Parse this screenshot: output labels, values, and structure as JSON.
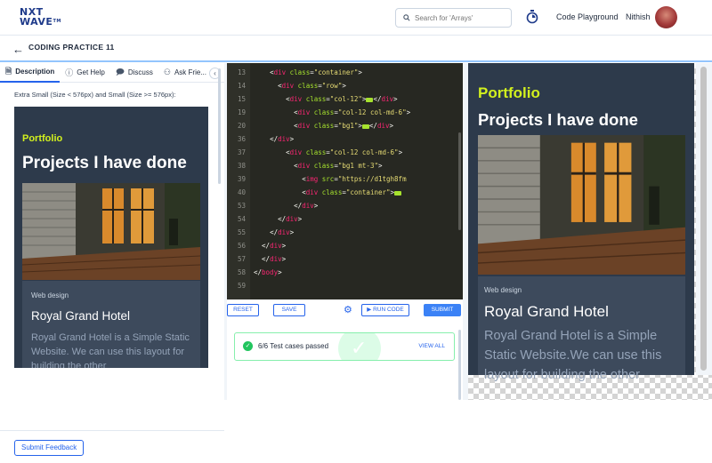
{
  "header": {
    "logo_line1": "NXT",
    "logo_line2": "WAVE",
    "logo_tm": "TM",
    "search_placeholder": "Search for 'Arrays'",
    "playground_label": "Code Playground",
    "user_name": "Nithish"
  },
  "subheader": {
    "title": "CODING PRACTICE 11"
  },
  "left_panel": {
    "tabs": [
      {
        "label": "Description",
        "icon": "document-icon"
      },
      {
        "label": "Get Help",
        "icon": "help-icon"
      },
      {
        "label": "Discuss",
        "icon": "chat-icon"
      },
      {
        "label": "Ask Frie...",
        "icon": "people-icon"
      }
    ],
    "description_text": "Extra Small (Size < 576px) and Small (Size >= 576px):",
    "preview": {
      "portfolio": "Portfolio",
      "title": "Projects I have done",
      "tag": "Web design",
      "hotel": "Royal Grand Hotel",
      "paragraph": "Royal Grand Hotel is a Simple Static Website. We can use this layout for building the other"
    },
    "feedback_button": "Submit Feedback"
  },
  "editor": {
    "lines": [
      {
        "num": "13",
        "indent": "    ",
        "code": [
          [
            "punct",
            "<"
          ],
          [
            "tag-name",
            "div "
          ],
          [
            "attr",
            "class"
          ],
          [
            "punct",
            "="
          ],
          [
            "str",
            "\"container\""
          ],
          [
            "punct",
            ">"
          ]
        ]
      },
      {
        "num": "14",
        "indent": "      ",
        "code": [
          [
            "punct",
            "<"
          ],
          [
            "tag-name",
            "div "
          ],
          [
            "attr",
            "class"
          ],
          [
            "punct",
            "="
          ],
          [
            "str",
            "\"row\""
          ],
          [
            "punct",
            ">"
          ]
        ]
      },
      {
        "num": "15",
        "indent": "        ",
        "code": [
          [
            "punct",
            "<"
          ],
          [
            "tag-name",
            "div "
          ],
          [
            "attr",
            "class"
          ],
          [
            "punct",
            "="
          ],
          [
            "str",
            "\"col-12\""
          ],
          [
            "punct",
            ">"
          ],
          [
            "fold",
            ""
          ],
          [
            "punct",
            "</"
          ],
          [
            "tag-name",
            "div"
          ],
          [
            "punct",
            ">"
          ]
        ]
      },
      {
        "num": "19",
        "indent": "          ",
        "code": [
          [
            "punct",
            "<"
          ],
          [
            "tag-name",
            "div "
          ],
          [
            "attr",
            "class"
          ],
          [
            "punct",
            "="
          ],
          [
            "str",
            "\"col-12 col-md-6\""
          ],
          [
            "punct",
            ">"
          ]
        ]
      },
      {
        "num": "20",
        "indent": "          ",
        "code": [
          [
            "punct",
            "<"
          ],
          [
            "tag-name",
            "div "
          ],
          [
            "attr",
            "class"
          ],
          [
            "punct",
            "="
          ],
          [
            "str",
            "\"bg1\""
          ],
          [
            "punct",
            ">"
          ],
          [
            "fold",
            ""
          ],
          [
            "punct",
            "</"
          ],
          [
            "tag-name",
            "div"
          ],
          [
            "punct",
            ">"
          ]
        ]
      },
      {
        "num": "36",
        "indent": "    ",
        "code": [
          [
            "punct",
            "</"
          ],
          [
            "tag-name",
            "div"
          ],
          [
            "punct",
            ">"
          ]
        ]
      },
      {
        "num": "37",
        "indent": "        ",
        "code": [
          [
            "punct",
            "<"
          ],
          [
            "tag-name",
            "div "
          ],
          [
            "attr",
            "class"
          ],
          [
            "punct",
            "="
          ],
          [
            "str",
            "\"col-12 col-md-6\""
          ],
          [
            "punct",
            ">"
          ]
        ]
      },
      {
        "num": "38",
        "indent": "          ",
        "code": [
          [
            "punct",
            "<"
          ],
          [
            "tag-name",
            "div "
          ],
          [
            "attr",
            "class"
          ],
          [
            "punct",
            "="
          ],
          [
            "str",
            "\"bg1 mt-3\""
          ],
          [
            "punct",
            ">"
          ]
        ]
      },
      {
        "num": "39",
        "indent": "            ",
        "code": [
          [
            "punct",
            "<"
          ],
          [
            "tag-name",
            "img "
          ],
          [
            "attr",
            "src"
          ],
          [
            "punct",
            "="
          ],
          [
            "str",
            "\"https://d1tgh8fm"
          ]
        ]
      },
      {
        "num": "40",
        "indent": "            ",
        "code": [
          [
            "punct",
            "<"
          ],
          [
            "tag-name",
            "div "
          ],
          [
            "attr",
            "class"
          ],
          [
            "punct",
            "="
          ],
          [
            "str",
            "\"container\""
          ],
          [
            "punct",
            ">"
          ],
          [
            "fold",
            ""
          ]
        ]
      },
      {
        "num": "53",
        "indent": "          ",
        "code": [
          [
            "punct",
            "</"
          ],
          [
            "tag-name",
            "div"
          ],
          [
            "punct",
            ">"
          ]
        ]
      },
      {
        "num": "54",
        "indent": "      ",
        "code": [
          [
            "punct",
            "</"
          ],
          [
            "tag-name",
            "div"
          ],
          [
            "punct",
            ">"
          ]
        ]
      },
      {
        "num": "55",
        "indent": "    ",
        "code": [
          [
            "punct",
            "</"
          ],
          [
            "tag-name",
            "div"
          ],
          [
            "punct",
            ">"
          ]
        ]
      },
      {
        "num": "56",
        "indent": "  ",
        "code": [
          [
            "punct",
            "</"
          ],
          [
            "tag-name",
            "div"
          ],
          [
            "punct",
            ">"
          ]
        ]
      },
      {
        "num": "57",
        "indent": "  ",
        "code": [
          [
            "punct",
            "</"
          ],
          [
            "tag-name",
            "div"
          ],
          [
            "punct",
            ">"
          ]
        ]
      },
      {
        "num": "58",
        "indent": "",
        "code": [
          [
            "punct",
            "</"
          ],
          [
            "tag-name",
            "body"
          ],
          [
            "punct",
            ">"
          ]
        ]
      },
      {
        "num": "59",
        "indent": "",
        "code": []
      }
    ]
  },
  "toolbar": {
    "reset": "RESET",
    "save": "SAVE",
    "run": "RUN CODE",
    "submit": "SUBMIT"
  },
  "tests": {
    "status": "6/6 Test cases passed",
    "view_all": "VIEW ALL"
  },
  "right_preview": {
    "portfolio": "Portfolio",
    "title": "Projects I have done",
    "tag": "Web design",
    "hotel": "Royal Grand Hotel",
    "paragraph": "Royal Grand Hotel is a Simple Static Website.We can use this layout for building the other"
  },
  "colors": {
    "accent": "#2563eb",
    "portfolio_yellow": "#d2f01e",
    "preview_bg": "#2d3a4b",
    "editor_bg": "#272822",
    "pass_green": "#22c55e"
  }
}
